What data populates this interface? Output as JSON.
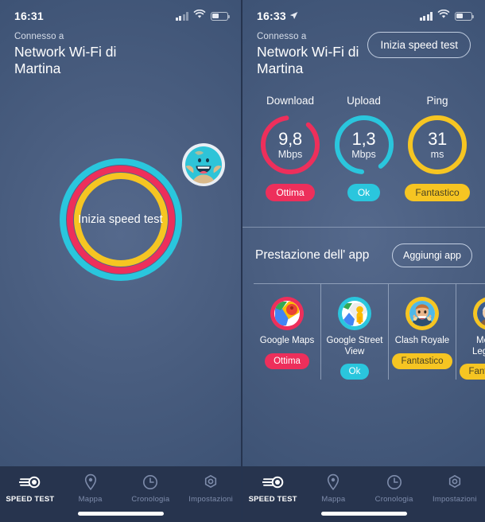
{
  "colors": {
    "pink": "#ed2f5b",
    "cyan": "#2ac6dd",
    "yellow": "#f6c522",
    "bg_dark": "#334566",
    "bg_light": "#55698c",
    "tabbar": "#27344e"
  },
  "left": {
    "status": {
      "time": "16:31",
      "location_arrow": false
    },
    "header": {
      "subtitle": "Connesso a",
      "network": "Network Wi-Fi di Martina"
    },
    "start_button": {
      "label": "Inizia speed test"
    },
    "avatar": {
      "name": "globe-smiley-avatar"
    }
  },
  "right": {
    "status": {
      "time": "16:33",
      "location_arrow": true
    },
    "header": {
      "subtitle": "Connesso a",
      "network": "Network Wi-Fi di Martina"
    },
    "start_test_button": {
      "label": "Inizia speed test"
    },
    "metrics": [
      {
        "title": "Download",
        "value": "9,8",
        "unit": "Mbps",
        "badge": "Ottima",
        "color": "#ed2f5b",
        "badge_text_dark": false,
        "arc_pct": 86,
        "arc_start": -48
      },
      {
        "title": "Upload",
        "value": "1,3",
        "unit": "Mbps",
        "badge": "Ok",
        "color": "#2ac6dd",
        "badge_text_dark": false,
        "arc_pct": 88,
        "arc_start": 95
      },
      {
        "title": "Ping",
        "value": "31",
        "unit": "ms",
        "badge": "Fantastico",
        "color": "#f6c522",
        "badge_text_dark": true,
        "arc_pct": 100,
        "arc_start": 0
      }
    ],
    "apps_section": {
      "title": "Prestazione dell' app",
      "add_button": "Aggiungi app",
      "apps": [
        {
          "name": "Google Maps",
          "badge": "Ottima",
          "color": "#ed2f5b",
          "badge_text_dark": false,
          "icon": "google-maps-icon"
        },
        {
          "name": "Google Street View",
          "badge": "Ok",
          "color": "#2ac6dd",
          "badge_text_dark": false,
          "icon": "google-street-view-icon"
        },
        {
          "name": "Clash Royale",
          "badge": "Fantastico",
          "color": "#f6c522",
          "badge_text_dark": true,
          "icon": "clash-royale-icon"
        },
        {
          "name": "Mobile Legends",
          "badge": "Fantastico",
          "color": "#f6c522",
          "badge_text_dark": true,
          "icon": "mobile-legends-icon"
        }
      ]
    }
  },
  "tabbar": {
    "items": [
      {
        "label": "SPEED TEST",
        "icon": "speedometer-icon",
        "active": true
      },
      {
        "label": "Mappa",
        "icon": "map-pin-icon",
        "active": false
      },
      {
        "label": "Cronologia",
        "icon": "clock-icon",
        "active": false
      },
      {
        "label": "Impostazioni",
        "icon": "gear-icon",
        "active": false
      }
    ]
  }
}
